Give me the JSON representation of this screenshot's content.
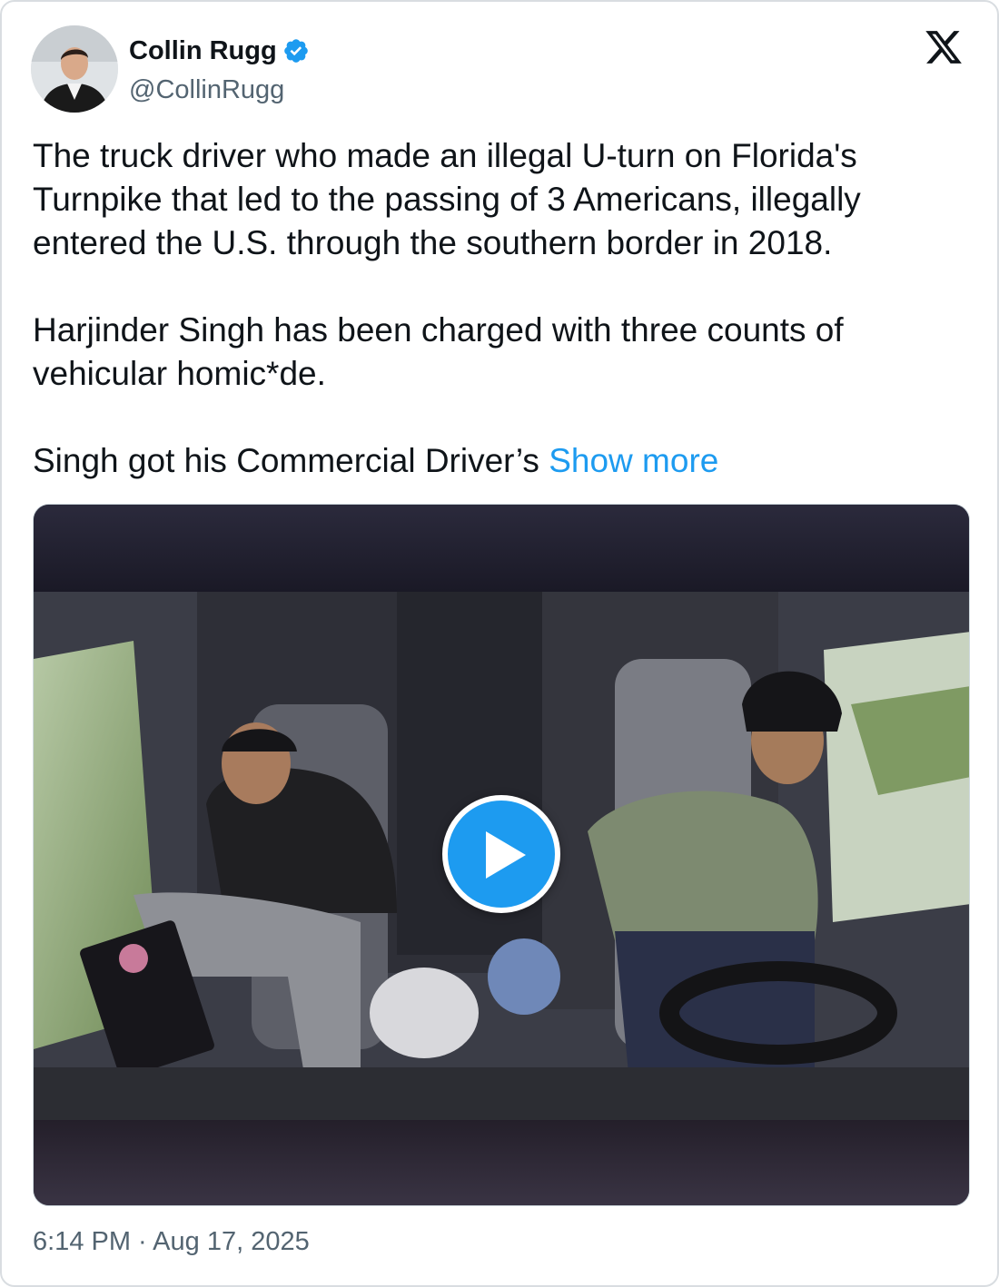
{
  "author": {
    "display_name": "Collin Rugg",
    "handle": "@CollinRugg",
    "verified": true
  },
  "icons": {
    "verified": "verified-badge-icon",
    "platform": "x-logo-icon",
    "play": "play-icon"
  },
  "tweet": {
    "paragraph_1": "The truck driver who made an illegal U-turn on Florida's Turnpike that led to the passing of 3 Americans, illegally entered the U.S. through the southern border in 2018.",
    "paragraph_2": "Harjinder Singh has been charged with three counts of vehicular homic*de.",
    "paragraph_3": "Singh got his Commercial Driver’s",
    "show_more": "Show more"
  },
  "media": {
    "type": "video"
  },
  "timestamp": "6:14 PM · Aug 17, 2025",
  "colors": {
    "accent": "#1d9bf0",
    "text": "#0f1419",
    "secondary_text": "#536471",
    "border": "#d9dde1"
  }
}
